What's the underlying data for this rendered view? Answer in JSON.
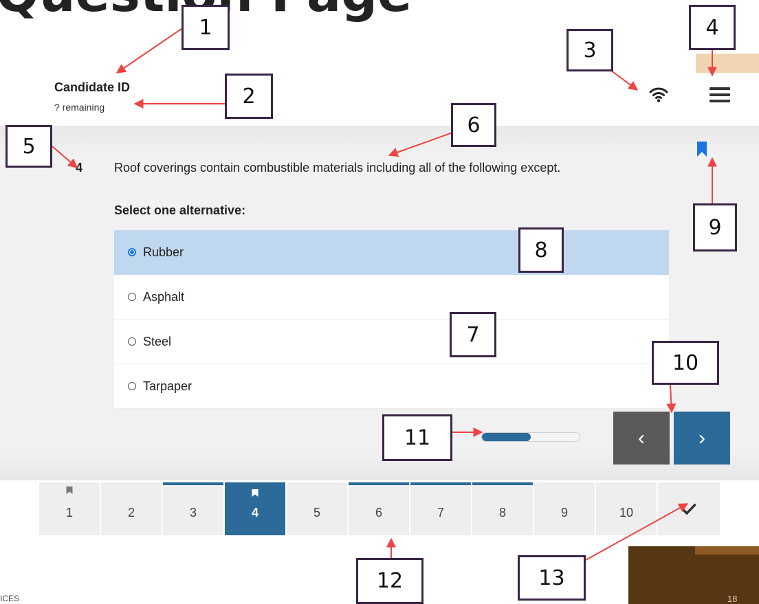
{
  "slide": {
    "title": "Question Page",
    "footer_text": "ICES",
    "page_number": "18"
  },
  "header": {
    "candidate_label": "Candidate ID",
    "remaining_text": "? remaining",
    "wifi_icon": "wifi-icon",
    "menu_icon": "hamburger-menu-icon"
  },
  "question": {
    "number": "4",
    "text": "Roof coverings contain combustible materials including all of the following except.",
    "instruction": "Select one alternative:",
    "bookmarked": true,
    "options": [
      {
        "label": "Rubber",
        "selected": true
      },
      {
        "label": "Asphalt",
        "selected": false
      },
      {
        "label": "Steel",
        "selected": false
      },
      {
        "label": "Tarpaper",
        "selected": false
      }
    ]
  },
  "progress": {
    "fraction": 0.5
  },
  "navigation": {
    "prev_symbol": "‹",
    "next_symbol": "›",
    "items": [
      {
        "label": "1",
        "answered": false,
        "bookmarked": true,
        "current": false
      },
      {
        "label": "2",
        "answered": false,
        "bookmarked": false,
        "current": false
      },
      {
        "label": "3",
        "answered": true,
        "bookmarked": false,
        "current": false
      },
      {
        "label": "4",
        "answered": true,
        "bookmarked": true,
        "current": true
      },
      {
        "label": "5",
        "answered": false,
        "bookmarked": false,
        "current": false
      },
      {
        "label": "6",
        "answered": true,
        "bookmarked": false,
        "current": false
      },
      {
        "label": "7",
        "answered": true,
        "bookmarked": false,
        "current": false
      },
      {
        "label": "8",
        "answered": true,
        "bookmarked": false,
        "current": false
      },
      {
        "label": "9",
        "answered": false,
        "bookmarked": false,
        "current": false
      },
      {
        "label": "10",
        "answered": false,
        "bookmarked": false,
        "current": false
      }
    ],
    "finish_icon": "checkmark-icon"
  },
  "callouts": [
    "1",
    "2",
    "3",
    "4",
    "5",
    "6",
    "7",
    "8",
    "9",
    "10",
    "11",
    "12",
    "13"
  ],
  "colors": {
    "primary": "#2b6a99",
    "selected_option": "#c0d8ef",
    "callout_border": "#3a2546",
    "arrow": "#ee4444",
    "prev_button": "#5a5a5a",
    "bookmark": "#1a73e8"
  }
}
